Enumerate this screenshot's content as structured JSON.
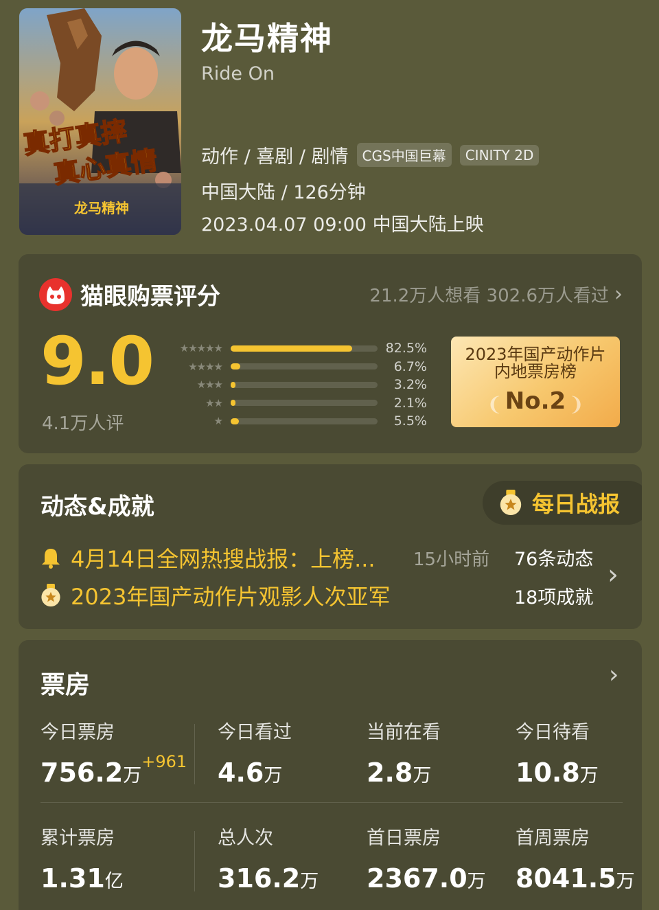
{
  "movie": {
    "title": "龙马精神",
    "subtitle": "Ride On",
    "genres": "动作 / 喜剧 / 剧情",
    "tags": [
      "CGS中国巨幕",
      "CINITY 2D"
    ],
    "region_duration": "中国大陆 / 126分钟",
    "release": "2023.04.07 09:00 中国大陆上映",
    "poster": {
      "slogan_line1": "真打真摔",
      "slogan_line2": "真心真情",
      "logo": "龙马精神"
    }
  },
  "rating": {
    "title": "猫眼购票评分",
    "stats": "21.2万人想看 302.6万人看过",
    "score": "9.0",
    "count": "4.1万人评",
    "distribution": [
      {
        "stars": "★★★★★",
        "pct_label": "82.5%",
        "pct": 82.5
      },
      {
        "stars": "★★★★",
        "pct_label": "6.7%",
        "pct": 6.7
      },
      {
        "stars": "★★★",
        "pct_label": "3.2%",
        "pct": 3.2
      },
      {
        "stars": "★★",
        "pct_label": "2.1%",
        "pct": 2.1
      },
      {
        "stars": "★",
        "pct_label": "5.5%",
        "pct": 5.5
      }
    ],
    "rank": {
      "line1": "2023年国产动作片",
      "line2": "内地票房榜",
      "no": "No.2"
    }
  },
  "news": {
    "title": "动态&成就",
    "daily_button": "每日战报",
    "item1": "4月14日全网热搜战报：上榜...",
    "item1_time": "15小时前",
    "item2": "2023年国产动作片观影人次亚军",
    "count1": "76条动态",
    "count2": "18项成就"
  },
  "boxoffice": {
    "title": "票房",
    "metrics": [
      {
        "label": "今日票房",
        "num": "756.2",
        "unit": "万",
        "delta": "+961"
      },
      {
        "label": "今日看过",
        "num": "4.6",
        "unit": "万"
      },
      {
        "label": "当前在看",
        "num": "2.8",
        "unit": "万"
      },
      {
        "label": "今日待看",
        "num": "10.8",
        "unit": "万"
      },
      {
        "label": "累计票房",
        "num": "1.31",
        "unit": "亿"
      },
      {
        "label": "总人次",
        "num": "316.2",
        "unit": "万"
      },
      {
        "label": "首日票房",
        "num": "2367.0",
        "unit": "万"
      },
      {
        "label": "首周票房",
        "num": "8041.5",
        "unit": "万"
      }
    ]
  },
  "colors": {
    "background": "#5a5a3a",
    "card": "#4a4a33",
    "accent": "#f5c431",
    "brand_red": "#e8322d"
  },
  "icons": {
    "maoyan_logo": "maoyan-cat-icon",
    "bell": "bell-icon",
    "medal": "medal-icon",
    "chevron": "chevron-right-icon"
  }
}
